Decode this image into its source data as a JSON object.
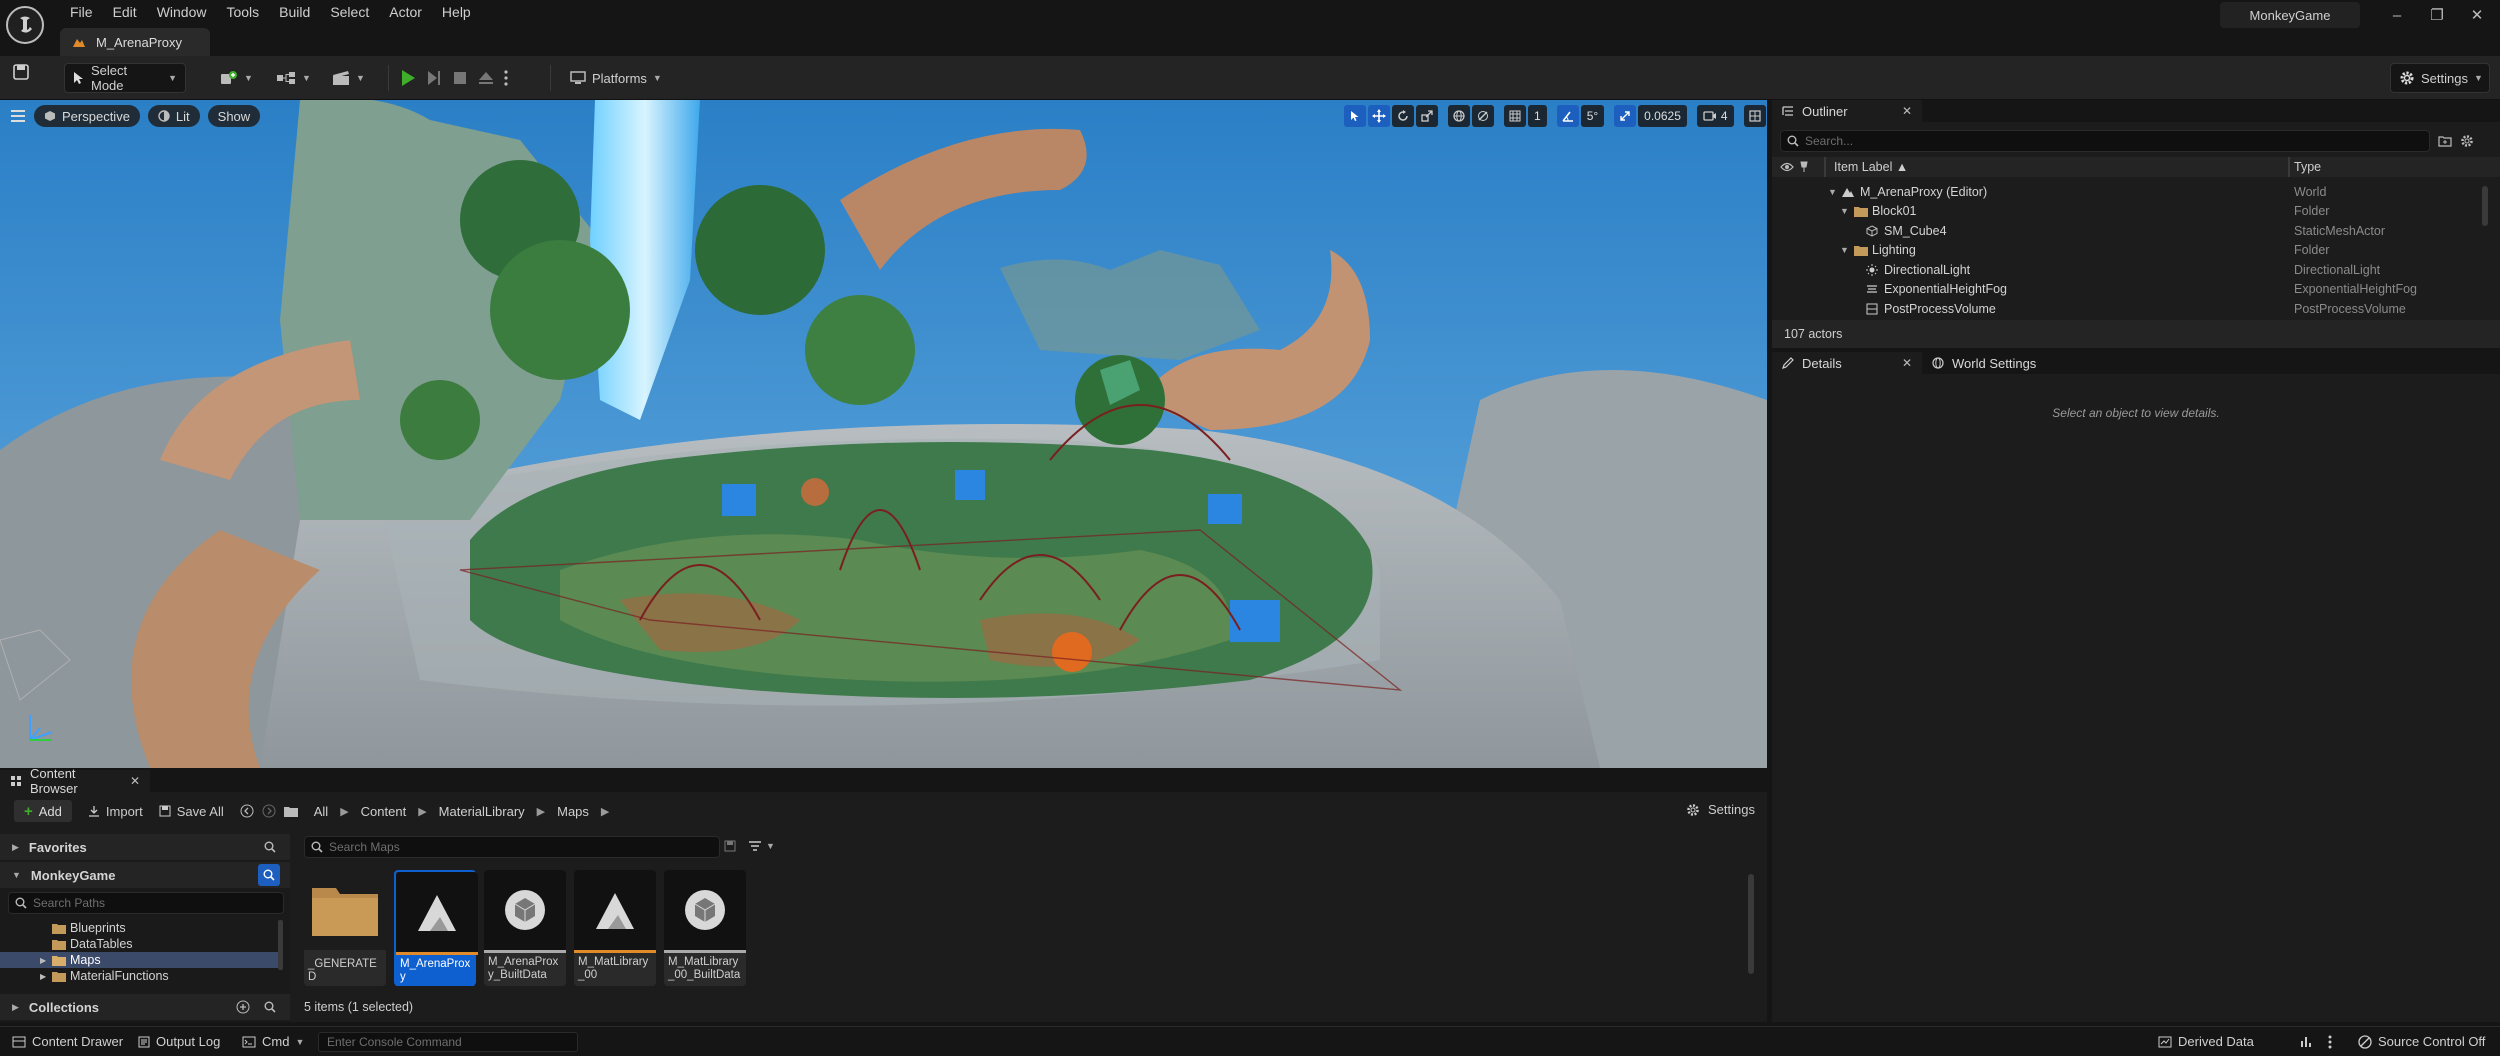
{
  "app": {
    "project_name": "MonkeyGame",
    "document_tab": "M_ArenaProxy",
    "menu": [
      "File",
      "Edit",
      "Window",
      "Tools",
      "Build",
      "Select",
      "Actor",
      "Help"
    ],
    "window_controls": {
      "minimize": "–",
      "maximize": "❐",
      "close": "✕"
    }
  },
  "toolbar": {
    "select_mode": "Select Mode",
    "platforms": "Platforms",
    "settings": "Settings"
  },
  "viewport": {
    "perspective": "Perspective",
    "lit": "Lit",
    "show": "Show",
    "grid_snap": "1",
    "rotation_snap": "5°",
    "scale_snap": "0.0625",
    "camera_speed": "4"
  },
  "outliner": {
    "tab": "Outliner",
    "search_placeholder": "Search...",
    "col_label": "Item Label ▲",
    "col_type": "Type",
    "rows": [
      {
        "label": "M_ArenaProxy (Editor)",
        "type": "World"
      },
      {
        "label": "Block01",
        "type": "Folder"
      },
      {
        "label": "SM_Cube4",
        "type": "StaticMeshActor"
      },
      {
        "label": "Lighting",
        "type": "Folder"
      },
      {
        "label": "DirectionalLight",
        "type": "DirectionalLight"
      },
      {
        "label": "ExponentialHeightFog",
        "type": "ExponentialHeightFog"
      },
      {
        "label": "PostProcessVolume",
        "type": "PostProcessVolume"
      }
    ],
    "count": "107 actors"
  },
  "details": {
    "tab": "Details",
    "tab2": "World Settings",
    "empty_msg": "Select an object to view details."
  },
  "content_browser": {
    "tab": "Content Browser",
    "add": "Add",
    "import": "Import",
    "save_all": "Save All",
    "breadcrumb": [
      "All",
      "Content",
      "MaterialLibrary",
      "Maps"
    ],
    "settings": "Settings",
    "favorites": "Favorites",
    "project": "MonkeyGame",
    "search_paths_placeholder": "Search Paths",
    "search_assets_placeholder": "Search Maps",
    "tree": [
      "Blueprints",
      "DataTables",
      "Maps",
      "MaterialFunctions"
    ],
    "collections": "Collections",
    "assets": [
      {
        "label": "_GENERATED",
        "kind": "folder"
      },
      {
        "label": "M_ArenaProxy",
        "kind": "map"
      },
      {
        "label": "M_ArenaProxy_BuiltData",
        "kind": "data"
      },
      {
        "label": "M_MatLibrary_00",
        "kind": "map"
      },
      {
        "label": "M_MatLibrary_00_BuiltData",
        "kind": "data"
      }
    ],
    "status": "5 items (1 selected)"
  },
  "statusbar": {
    "content_drawer": "Content Drawer",
    "output_log": "Output Log",
    "cmd": "Cmd",
    "console_placeholder": "Enter Console Command",
    "derived_data": "Derived Data",
    "source_control": "Source Control Off"
  },
  "colors": {
    "accent_blue": "#1d5fbf",
    "play_green": "#3fae2a",
    "selection": "#0e60d0"
  }
}
